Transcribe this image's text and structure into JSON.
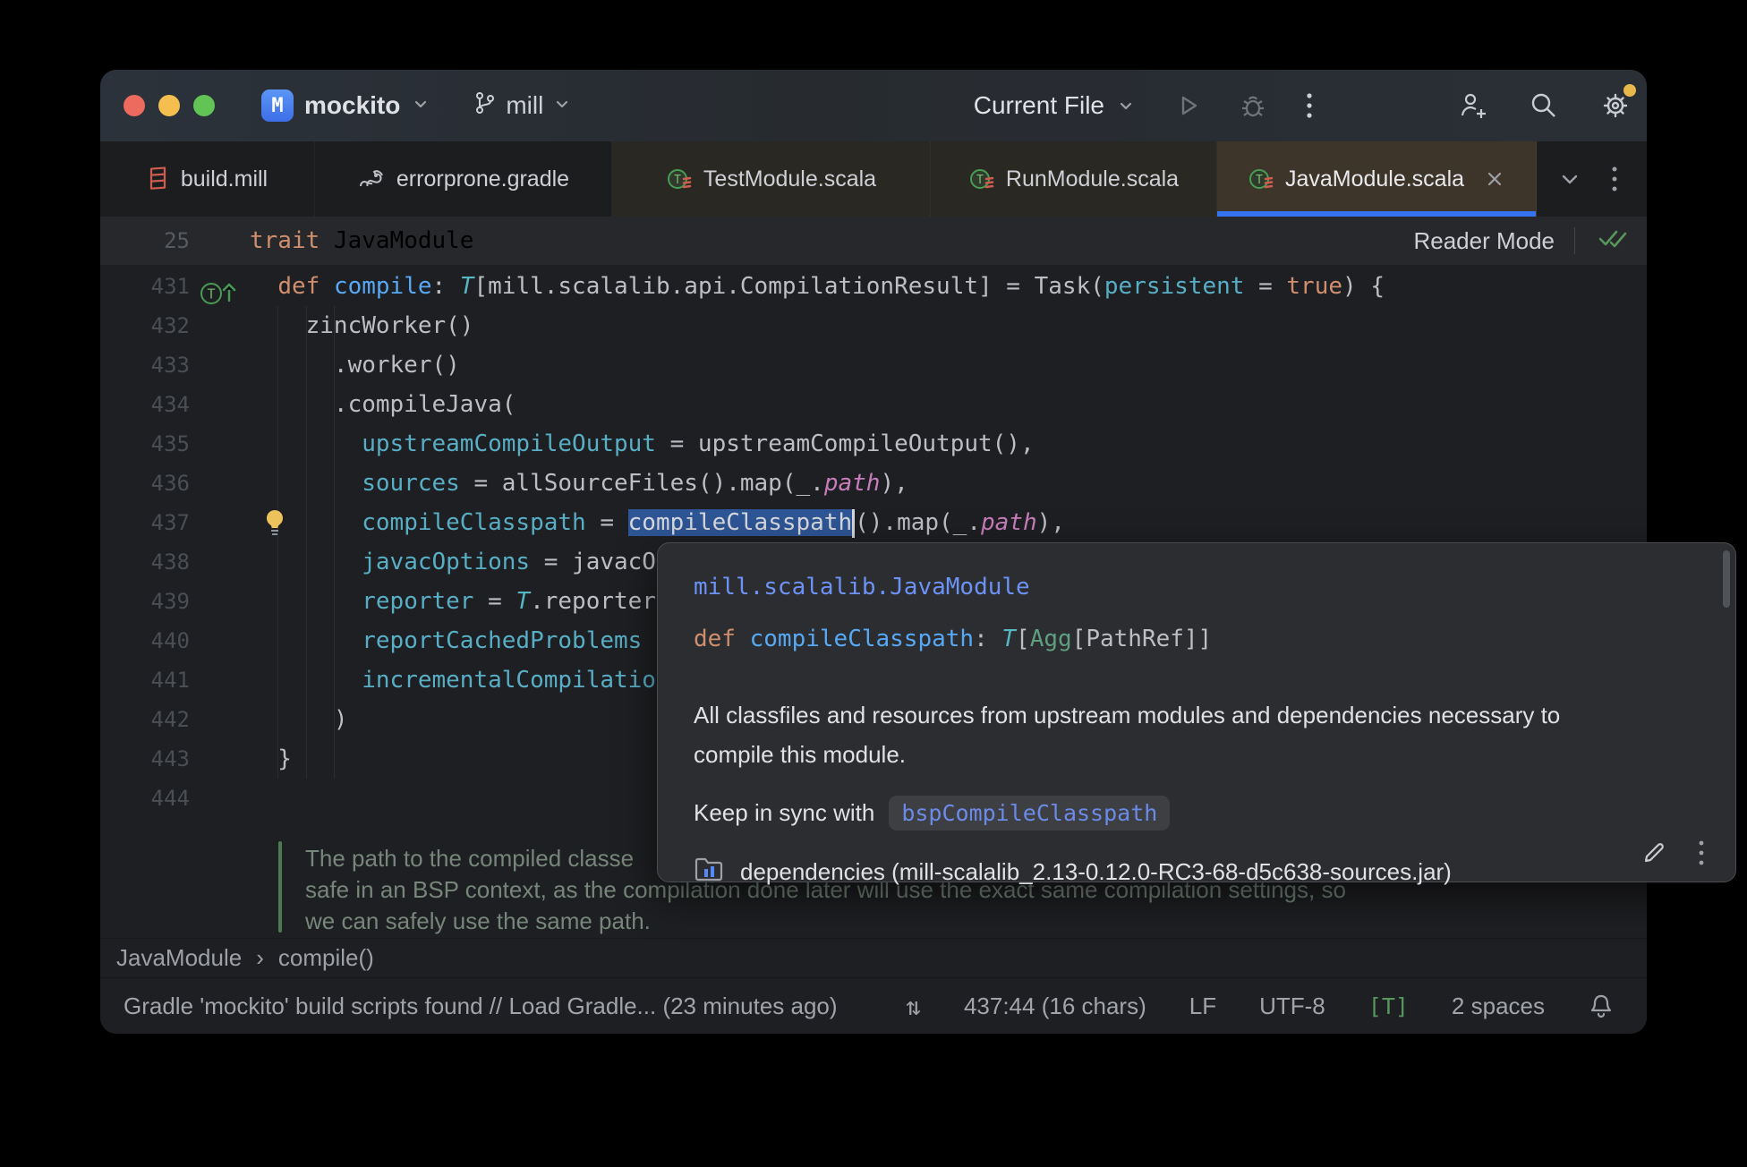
{
  "colors": {
    "accent_blue": "#3574F0",
    "selection_blue": "#2E5595",
    "keyword_orange": "#CF8E6D",
    "function_blue": "#57A8F5",
    "named_arg_cyan": "#58AEC5",
    "field_pink": "#C77DBB",
    "traffic_red": "#EC6A5E",
    "traffic_yellow": "#F5BF4F",
    "traffic_green": "#61C455",
    "notification_dot": "#E8B84B",
    "green_check": "#57965C",
    "active_tab_bg": "#3E352A",
    "popup_bg": "#2B2D30"
  },
  "titlebar": {
    "project_initial": "M",
    "project_name": "mockito",
    "branch_name": "mill",
    "run_config": "Current File"
  },
  "tabs": [
    {
      "label": "build.mill",
      "icon": "mill",
      "state": "normal"
    },
    {
      "label": "errorprone.gradle",
      "icon": "gradle",
      "state": "normal"
    },
    {
      "label": "TestModule.scala",
      "icon": "scala-trait",
      "state": "library"
    },
    {
      "label": "RunModule.scala",
      "icon": "scala-trait",
      "state": "library"
    },
    {
      "label": "JavaModule.scala",
      "icon": "scala-trait",
      "state": "active",
      "closable": true
    }
  ],
  "sticky": {
    "line_number": "25",
    "code": [
      [
        "trait ",
        "kw"
      ],
      [
        "JavaModule",
        ""
      ]
    ],
    "reader_mode_label": "Reader Mode"
  },
  "editor": {
    "lines": [
      {
        "n": "431",
        "icon": "override",
        "segs": [
          [
            "  ",
            ""
          ],
          [
            "def ",
            "kw"
          ],
          [
            "compile",
            "fn"
          ],
          [
            ": ",
            ""
          ],
          [
            "T",
            "type"
          ],
          [
            "[mill.scalalib.api.CompilationResult] = Task(",
            ""
          ],
          [
            "persistent",
            "arg"
          ],
          [
            " = ",
            ""
          ],
          [
            "true",
            "kw"
          ],
          [
            ") {",
            ""
          ]
        ]
      },
      {
        "n": "432",
        "segs": [
          [
            "    zincWorker()",
            ""
          ]
        ]
      },
      {
        "n": "433",
        "segs": [
          [
            "      .worker()",
            ""
          ]
        ]
      },
      {
        "n": "434",
        "segs": [
          [
            "      .compileJava(",
            ""
          ]
        ]
      },
      {
        "n": "435",
        "segs": [
          [
            "        ",
            ""
          ],
          [
            "upstreamCompileOutput",
            "arg"
          ],
          [
            " = upstreamCompileOutput(),",
            ""
          ]
        ]
      },
      {
        "n": "436",
        "segs": [
          [
            "        ",
            ""
          ],
          [
            "sources",
            "arg"
          ],
          [
            " = allSourceFiles().map(_.",
            ""
          ],
          [
            "path",
            "field"
          ],
          [
            "),",
            ""
          ]
        ]
      },
      {
        "n": "437",
        "icon": "bulb",
        "segs": [
          [
            "        ",
            ""
          ],
          [
            "compileClasspath",
            "arg"
          ],
          [
            " = ",
            ""
          ],
          [
            "compileClasspath",
            "sel"
          ],
          [
            "",
            "caret"
          ],
          [
            "().map(_.",
            ""
          ],
          [
            "path",
            "field"
          ],
          [
            "),",
            ""
          ]
        ]
      },
      {
        "n": "438",
        "segs": [
          [
            "        ",
            ""
          ],
          [
            "javacOptions",
            "arg"
          ],
          [
            " = javacO",
            ""
          ]
        ]
      },
      {
        "n": "439",
        "segs": [
          [
            "        ",
            ""
          ],
          [
            "reporter",
            "arg"
          ],
          [
            " = ",
            ""
          ],
          [
            "T",
            "type"
          ],
          [
            ".reporter",
            ""
          ]
        ]
      },
      {
        "n": "440",
        "segs": [
          [
            "        ",
            ""
          ],
          [
            "reportCachedProblems",
            "arg"
          ]
        ]
      },
      {
        "n": "441",
        "segs": [
          [
            "        ",
            ""
          ],
          [
            "incrementalCompilatio",
            "arg"
          ]
        ]
      },
      {
        "n": "442",
        "segs": [
          [
            "      )",
            ""
          ]
        ]
      },
      {
        "n": "443",
        "segs": [
          [
            "  }",
            ""
          ]
        ]
      },
      {
        "n": "444",
        "segs": [
          [
            "",
            ""
          ]
        ]
      }
    ],
    "doc_lines": [
      "The path to the compiled classe",
      "safe in an BSP context, as the compilation done later will use the exact same compilation settings, so",
      "we can safely use the same path."
    ]
  },
  "breadcrumbs": [
    "JavaModule",
    "compile()"
  ],
  "statusbar": {
    "left_message": "Gradle 'mockito' build scripts found // Load Gradle... (23 minutes ago)",
    "caret_position": "437:44 (16 chars)",
    "line_ending": "LF",
    "encoding": "UTF-8",
    "badge": "[T]",
    "indent": "2 spaces"
  },
  "popup": {
    "qualifier": "mill.scalalib.JavaModule",
    "signature": [
      [
        "def ",
        "kw"
      ],
      [
        "compileClasspath",
        "fn"
      ],
      [
        ": ",
        ""
      ],
      [
        "T",
        "type"
      ],
      [
        "[",
        ""
      ],
      [
        "Agg",
        "cls"
      ],
      [
        "[PathRef]]",
        ""
      ]
    ],
    "description_line1": "All classfiles and resources from upstream modules and dependencies necessary to",
    "description_line2": "compile this module.",
    "sync_label": "Keep in sync with",
    "sync_chip": "bspCompileClasspath",
    "footer": "dependencies (mill-scalalib_2.13-0.12.0-RC3-68-d5c638-sources.jar)"
  }
}
